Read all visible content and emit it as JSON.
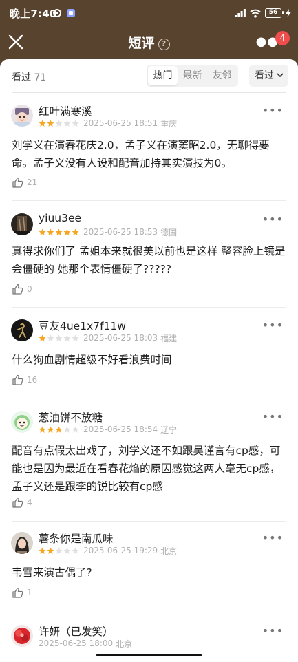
{
  "status_bar": {
    "time": "晚上7:40",
    "battery": "56"
  },
  "header": {
    "title": "短评",
    "help_glyph": "?",
    "badge_count": "4",
    "background": "#58432f"
  },
  "filter": {
    "watched_label": "看过",
    "watched_count": "71",
    "tabs": [
      "热门",
      "最新",
      "友邻"
    ],
    "active_tab": "热门",
    "sort_label": "看过"
  },
  "comments": [
    {
      "username": "红叶满寒溪",
      "rating": 2,
      "date": "2025-06-25 18:51",
      "location": "重庆",
      "content": "刘学义在演春花庆2.0，孟子义在演窦昭2.0，无聊得要命。孟子义没有人设和配音加持其实演技为0。",
      "likes": "21",
      "avatar": "cartoon-face"
    },
    {
      "username": "yiuu3ee",
      "rating": 5,
      "date": "2025-06-25 18:53",
      "location": "德国",
      "content": "真得求你们了 孟姐本来就很美以前也是这样 整容脸上镜是会僵硬的 她那个表情僵硬了?????",
      "likes": "0",
      "avatar": "dark-photo"
    },
    {
      "username": "豆友4ue1x7f11w",
      "rating": 1,
      "date": "2025-06-25 18:03",
      "location": "福建",
      "content": "什么狗血剧情超级不好看浪费时间",
      "likes": "16",
      "avatar": "dark-figure"
    },
    {
      "username": "葱油饼不放糖",
      "rating": 3,
      "date": "2025-06-25 18:54",
      "location": "辽宁",
      "content": "配音有点假太出戏了，刘学义还不如跟吴谨言有cp感，可能也是因为最近在看春花焰的原因感觉这两人毫无cp感，孟子义还是跟李的锐比较有cp感",
      "likes": "4",
      "avatar": "green-cartoon"
    },
    {
      "username": "薯条你是南瓜味",
      "rating": 2,
      "date": "2025-06-25 19:29",
      "location": "北京",
      "content": "韦雪来演古偶了?",
      "likes": "1",
      "avatar": "portrait"
    },
    {
      "username": "许妍（已发笑）",
      "rating": 0,
      "date": "2025-06-25 18:00",
      "location": "北京",
      "content": "",
      "likes": "",
      "avatar": "red-blossom"
    }
  ],
  "colors": {
    "star_filled": "#f5a623",
    "star_empty": "#e0e0e0",
    "badge": "#f04d4d"
  }
}
